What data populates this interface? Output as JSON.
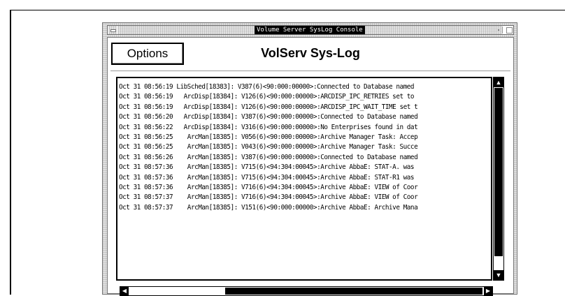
{
  "window": {
    "title": "Volume Server SysLog Console"
  },
  "toolbar": {
    "options_label": "Options"
  },
  "header": {
    "app_title": "VolServ Sys-Log"
  },
  "log": {
    "lines": [
      "Oct 31 08:56:19 LibSched[18383]: V387(6)<90:000:00000>:Connected to Database named",
      "Oct 31 08:56:19   ArcDisp[18384]: V126(6)<90:000:00000>:ARCDISP_IPC_RETRIES set to",
      "Oct 31 08:56:19   ArcDisp[18384]: V126(6)<90:000:00000>:ARCDISP_IPC_WAIT_TIME set t",
      "Oct 31 08:56:20   ArcDisp[18384]: V387(6)<90:000:00000>:Connected to Database named",
      "Oct 31 08:56:22   ArcDisp[18384]: V316(6)<90:000:00000>:No Enterprises found in dat",
      "Oct 31 08:56:25    ArcMan[18385]: V056(6)<90:000:00000>:Archive Manager Task: Accep",
      "Oct 31 08:56:25    ArcMan[18385]: V043(6)<90:000:00000>:Archive Manager Task: Succe",
      "Oct 31 08:56:26    ArcMan[18385]: V387(6)<90:000:00000>:Connected to Database named",
      "Oct 31 08:57:36    ArcMan[18385]: V715(6)<94:304:00045>:Archive AbbaE: STAT-A. was",
      "Oct 31 08:57:36    ArcMan[18385]: V715(6)<94:304:00045>:Archive AbbaE: STAT-R1 was",
      "Oct 31 08:57:36    ArcMan[18385]: V716(6)<94:304:00045>:Archive AbbaE: VIEW of Coor",
      "Oct 31 08:57:37    ArcMan[18385]: V716(6)<94:304:00045>:Archive AbbaE: VIEW of Coor",
      "Oct 31 08:57:37    ArcMan[18385]: V151(6)<90:000:00000>:Archive AbbaE: Archive Mana"
    ]
  },
  "icons": {
    "window_menu": "window-menu-icon",
    "minimize": "minimize-icon",
    "maximize": "maximize-icon",
    "scroll_up": "arrow-up-icon",
    "scroll_down": "arrow-down-icon",
    "scroll_left": "arrow-left-icon",
    "scroll_right": "arrow-right-icon"
  },
  "colors": {
    "background": "#ffffff",
    "window_chrome": "#e6e6e6",
    "text": "#000000",
    "scroll": "#000000"
  }
}
